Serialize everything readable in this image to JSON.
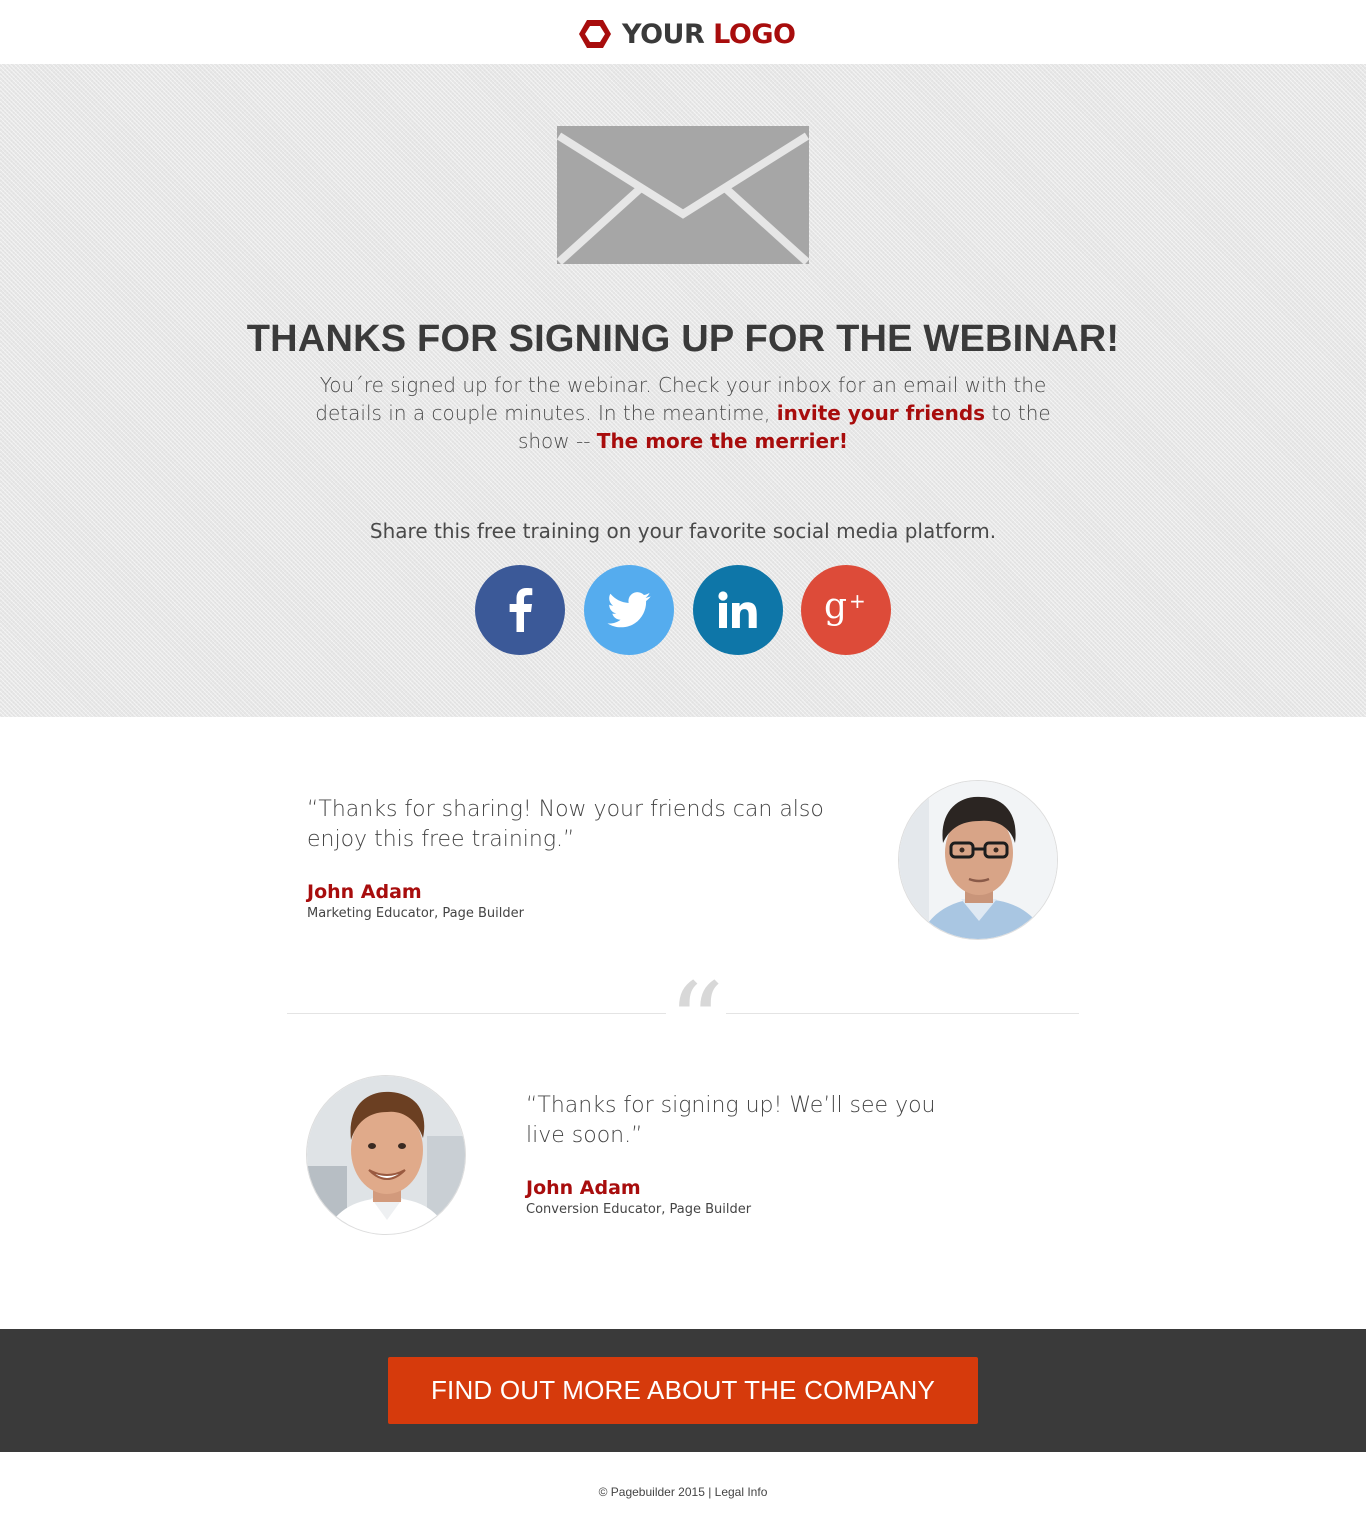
{
  "header": {
    "logo_word1": "YOUR",
    "logo_word2": "LOGO",
    "logo_icon": "hexagon-icon"
  },
  "hero": {
    "envelope_icon": "envelope-icon",
    "title": "THANKS FOR SIGNING UP FOR THE WEBINAR!",
    "text_part1": "You´re signed up for the webinar. Check your inbox for an email with the details in a couple minutes. In the meantime, ",
    "text_highlight1": "invite your friends",
    "text_part2": " to the show -- ",
    "text_highlight2": "The more the merrier!",
    "share_text": "Share this free training on your favorite social media platform.",
    "social": [
      {
        "name": "facebook-icon",
        "color": "#3b5998"
      },
      {
        "name": "twitter-icon",
        "color": "#55acee"
      },
      {
        "name": "linkedin-icon",
        "color": "#0e76a8"
      },
      {
        "name": "google-plus-icon",
        "color": "#dd4b39"
      }
    ]
  },
  "testimonials": [
    {
      "quote": "“Thanks for sharing! Now your friends can also enjoy this free training.”",
      "author": "John Adam",
      "role": "Marketing Educator, Page Builder"
    },
    {
      "quote": "“Thanks for signing up! We’ll see you live soon.”",
      "author": "John Adam",
      "role": "Conversion Educator, Page Builder"
    }
  ],
  "divider_glyph": "“",
  "cta": {
    "label": "FIND OUT MORE ABOUT THE COMPANY"
  },
  "footer": {
    "copyright": "© Pagebuilder 2015 | ",
    "legal": "Legal Info"
  },
  "colors": {
    "brand_red": "#a80d0d",
    "cta_orange": "#d63a0c",
    "dark_band": "#3a3a3a"
  }
}
